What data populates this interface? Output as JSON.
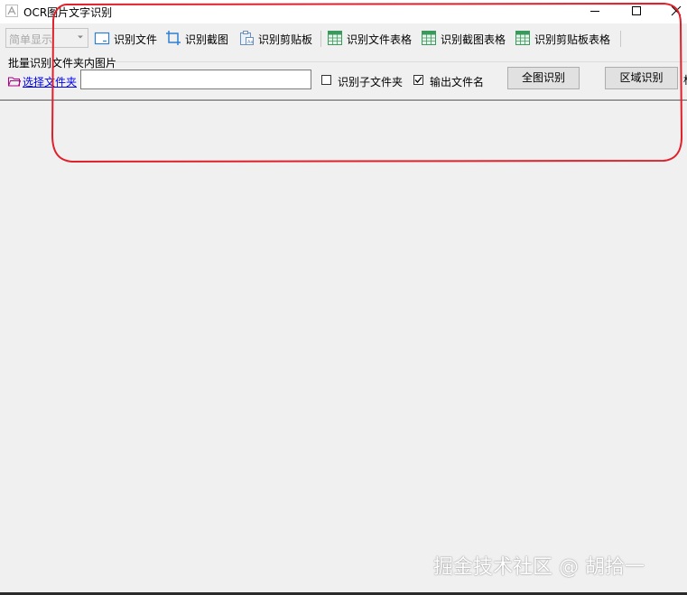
{
  "window": {
    "title": "OCR图片文字识别",
    "app_icon": "ocr-app-icon",
    "controls": {
      "minimize": "minimize-icon",
      "maximize": "maximize-icon",
      "close": "close-icon"
    }
  },
  "toolbar": {
    "display_mode": {
      "selected": "简单显示"
    },
    "items": [
      {
        "label": "识别文件",
        "icon": "file-icon"
      },
      {
        "label": "识别截图",
        "icon": "crop-icon"
      },
      {
        "label": "识别剪贴板",
        "icon": "clipboard-icon"
      },
      {
        "label": "识别文件表格",
        "icon": "table-icon"
      },
      {
        "label": "识别截图表格",
        "icon": "table-icon"
      },
      {
        "label": "识别剪贴板表格",
        "icon": "table-icon"
      }
    ]
  },
  "batch": {
    "title": "批量识别文件夹内图片",
    "select_folder_label": "选择文件夹",
    "folder_path": "",
    "include_subfolders": {
      "label": "识别子文件夹",
      "checked": false
    },
    "output_filename": {
      "label": "输出文件名",
      "checked": true
    },
    "full_image_button": "全图识别",
    "region_button": "区域识别",
    "truncated_text": "标"
  },
  "colors": {
    "annotation_outline": "#e0202a",
    "table_icon_green": "#3a9a5c",
    "link_blue": "#0000ee"
  },
  "watermark": "掘金技术社区 @ 胡拾一"
}
